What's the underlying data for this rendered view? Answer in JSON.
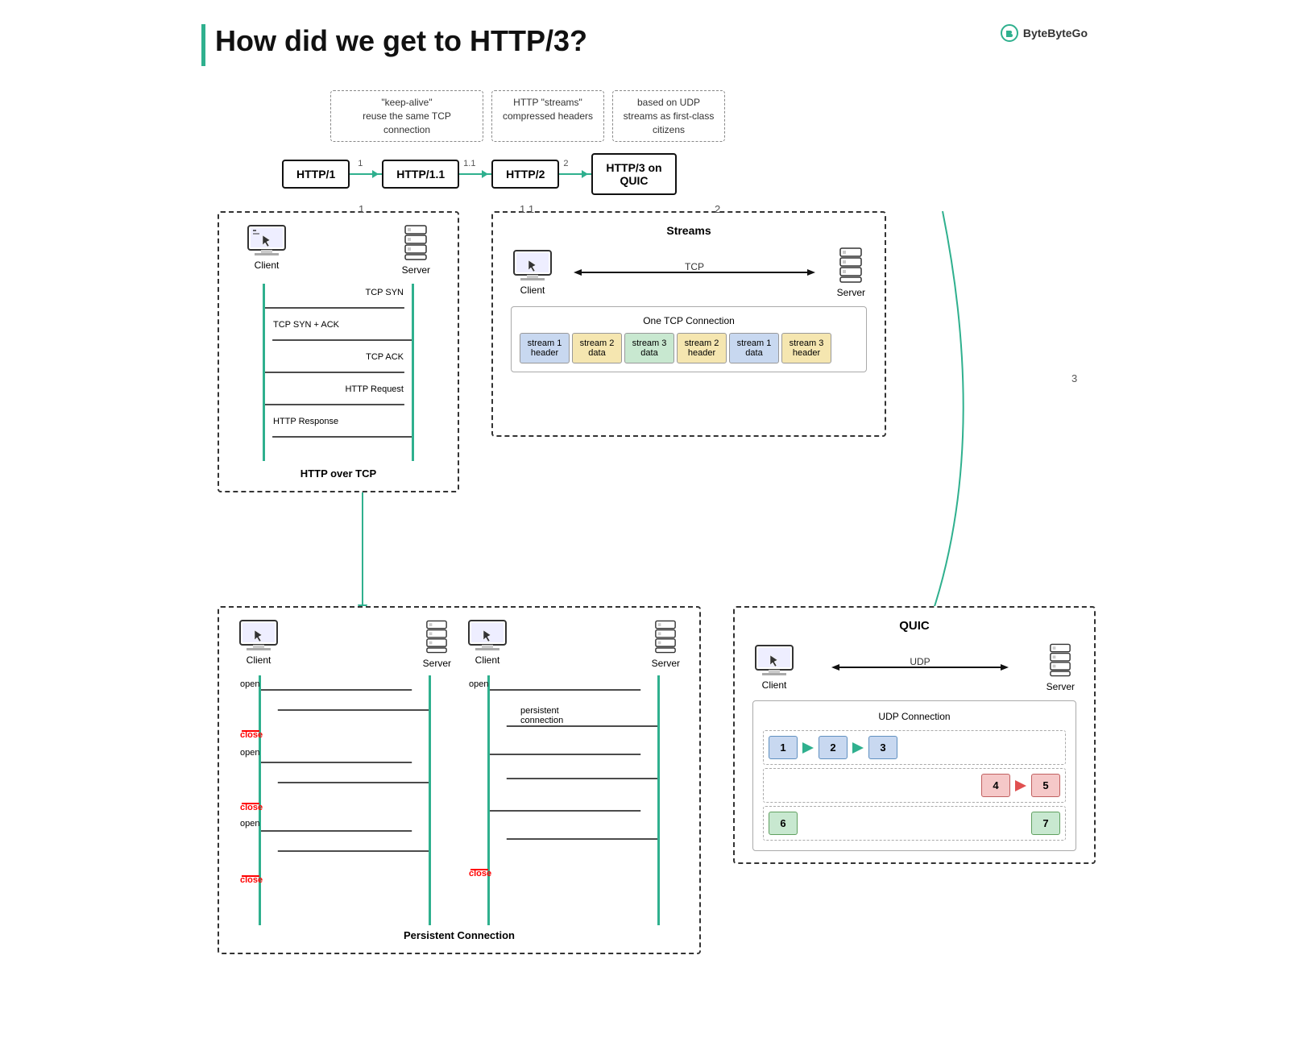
{
  "title": "How did we get to HTTP/3?",
  "logo": "ByteByteGo",
  "versions": [
    {
      "id": "http1",
      "label": "HTTP/1"
    },
    {
      "id": "http11",
      "label": "HTTP/1.1"
    },
    {
      "id": "http2",
      "label": "HTTP/2"
    },
    {
      "id": "http3",
      "label": "HTTP/3 on QUIC"
    }
  ],
  "notes": {
    "http11": "\"keep-alive\"\nreuse the same TCP connection",
    "http2": "HTTP \"streams\"\ncompressed headers",
    "http3": "based on UDP\nstreams as first-class citizens"
  },
  "tcp_section": {
    "label": "HTTP over TCP",
    "client": "Client",
    "server": "Server",
    "messages": [
      "TCP SYN",
      "TCP SYN + ACK",
      "TCP ACK",
      "HTTP Request",
      "HTTP Response"
    ]
  },
  "streams_section": {
    "label": "Streams",
    "connection_label": "One TCP Connection",
    "tcp_label": "TCP",
    "client": "Client",
    "server": "Server",
    "packets": [
      {
        "label": "stream 1\nheader",
        "color": "blue"
      },
      {
        "label": "stream 2\ndata",
        "color": "yellow"
      },
      {
        "label": "stream 3\ndata",
        "color": "green"
      },
      {
        "label": "stream 2\nheader",
        "color": "yellow"
      },
      {
        "label": "stream 1\ndata",
        "color": "blue"
      },
      {
        "label": "stream 3\nheader",
        "color": "yellow"
      }
    ]
  },
  "persistent_section": {
    "label": "Persistent Connection",
    "left": {
      "client": "Client",
      "server": "Server",
      "events": [
        "open",
        "close",
        "open",
        "close",
        "open",
        "close"
      ]
    },
    "right": {
      "client": "Client",
      "server": "Server",
      "label": "persistent\nconnection",
      "events": [
        "open",
        "close"
      ]
    }
  },
  "quic_section": {
    "label": "QUIC",
    "udp_label": "UDP",
    "connection_label": "UDP Connection",
    "client": "Client",
    "server": "Server",
    "stream1": [
      {
        "id": "1",
        "color": "blue"
      },
      {
        "id": "2",
        "color": "blue"
      },
      {
        "id": "3",
        "color": "blue"
      }
    ],
    "stream2": [
      {
        "id": "4",
        "color": "pink"
      },
      {
        "id": "5",
        "color": "pink"
      }
    ],
    "stream3": [
      {
        "id": "6",
        "color": "green"
      },
      {
        "id": "7",
        "color": "green"
      }
    ]
  },
  "version_labels": {
    "http1_to_11": "1",
    "http11_to_2": "1.1",
    "http2_to_3": "2",
    "quic_label": "3"
  }
}
